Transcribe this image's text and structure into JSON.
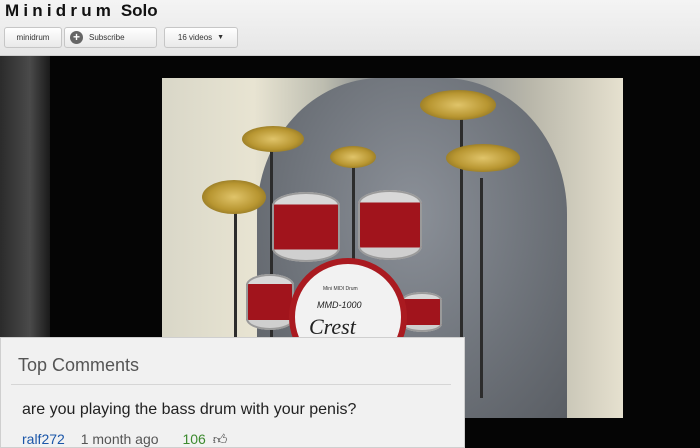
{
  "header": {
    "title_spaced": "Minidrum",
    "title_rest": "Solo",
    "channel_button": "minidrum",
    "subscribe_icon": "plus-icon",
    "subscribe_button": "Subscribe",
    "videos_button": "16 videos",
    "videos_caret": "▼"
  },
  "video": {
    "drum_brand_small": "Mini MIDI Drum",
    "drum_model": "MMD-1000",
    "drum_brand": "Crest"
  },
  "comments": {
    "heading": "Top Comments",
    "items": [
      {
        "text": "are you playing the bass drum with your penis?",
        "user": "ralf272",
        "time": "1 month ago",
        "likes": "106",
        "like_icon": "thumbs-up-icon"
      }
    ]
  },
  "colors": {
    "link": "#1b56a8",
    "likes": "#3c8a2e",
    "drum_red": "#a1141c"
  }
}
